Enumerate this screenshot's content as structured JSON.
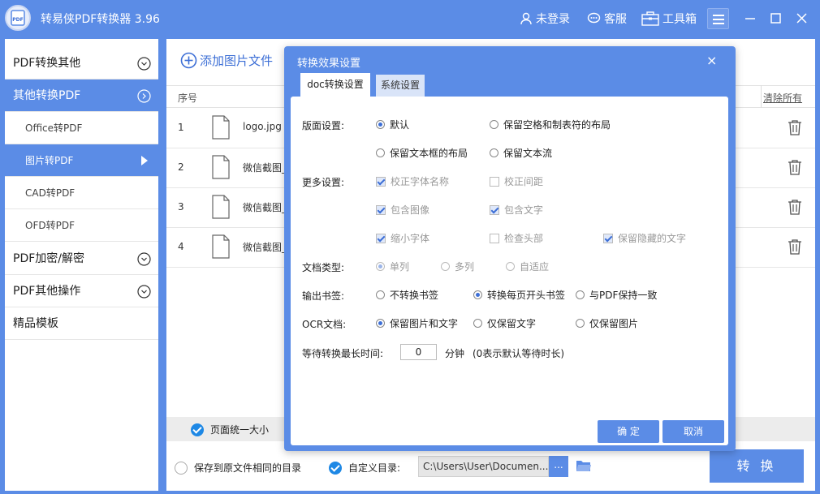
{
  "app": {
    "title": "转易侠PDF转换器 3.96"
  },
  "titlebar": {
    "login": "未登录",
    "service": "客服",
    "toolbox": "工具箱"
  },
  "sidebar": {
    "items": [
      {
        "label": "PDF转换其他"
      },
      {
        "label": "其他转换PDF"
      },
      {
        "label": "Office转PDF"
      },
      {
        "label": "图片转PDF"
      },
      {
        "label": "CAD转PDF"
      },
      {
        "label": "OFD转PDF"
      },
      {
        "label": "PDF加密/解密"
      },
      {
        "label": "PDF其他操作"
      },
      {
        "label": "精品模板"
      }
    ]
  },
  "main": {
    "add_label": "添加图片文件",
    "col_seq": "序号",
    "clear_all": "清除所有",
    "rows": [
      {
        "num": "1",
        "name": "logo.jpg"
      },
      {
        "num": "2",
        "name": "微信截图_"
      },
      {
        "num": "3",
        "name": "微信截图_"
      },
      {
        "num": "4",
        "name": "微信截图_"
      }
    ],
    "unify_label": "页面统一大小",
    "save_same_label": "保存到原文件相同的目录",
    "custom_dir_label": "自定义目录:",
    "path": "C:\\Users\\User\\Documen...",
    "dots": "...",
    "convert_label": "转 换"
  },
  "dialog": {
    "title": "转换效果设置",
    "close": "×",
    "tabs": [
      "doc转换设置",
      "系统设置"
    ],
    "layout_label": "版面设置:",
    "layout_opts": [
      "默认",
      "保留空格和制表符的布局",
      "保留文本框的布局",
      "保留文本流"
    ],
    "more_label": "更多设置:",
    "more_opts": [
      "校正字体名称",
      "校正间距",
      "包含图像",
      "包含文字",
      "缩小字体",
      "检查头部",
      "保留隐藏的文字"
    ],
    "doctype_label": "文档类型:",
    "doctype_opts": [
      "单列",
      "多列",
      "自适应"
    ],
    "bookmark_label": "输出书签:",
    "bookmark_opts": [
      "不转换书签",
      "转换每页开头书签",
      "与PDF保持一致"
    ],
    "ocr_label": "OCR文档:",
    "ocr_opts": [
      "保留图片和文字",
      "仅保留文字",
      "仅保留图片"
    ],
    "wait_label": "等待转换最长时间:",
    "wait_value": "0",
    "wait_unit": "分钟",
    "wait_note": "(0表示默认等待时长)",
    "ok": "确 定",
    "cancel": "取消"
  },
  "colors": {
    "accent": "#5b8ce6",
    "link": "#3d6fd6"
  }
}
